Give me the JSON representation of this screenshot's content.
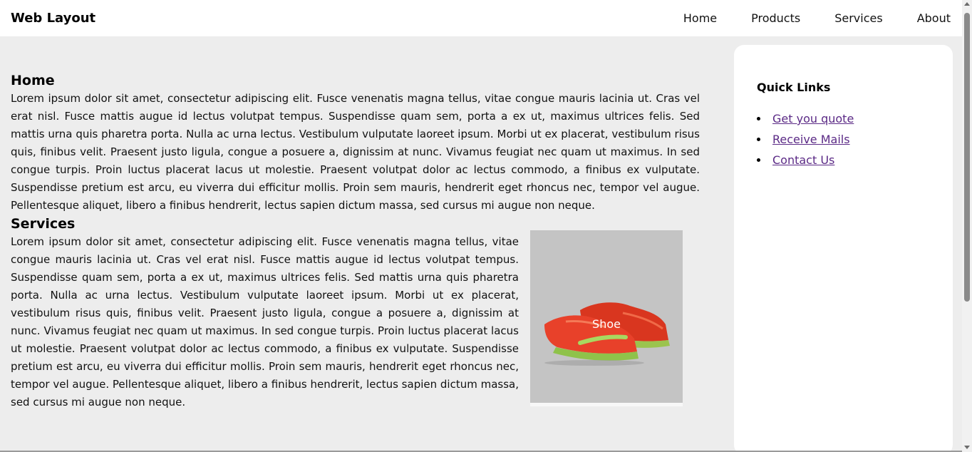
{
  "header": {
    "brand": "Web Layout",
    "nav": [
      "Home",
      "Products",
      "Services",
      "About"
    ]
  },
  "home": {
    "title": "Home",
    "text": "Lorem ipsum dolor sit amet, consectetur adipiscing elit. Fusce venenatis magna tellus, vitae congue mauris lacinia ut. Cras vel erat nisl. Fusce mattis augue id lectus volutpat tempus. Suspendisse quam sem, porta a ex ut, maximus ultrices felis. Sed mattis urna quis pharetra porta. Nulla ac urna lectus. Vestibulum vulputate laoreet ipsum. Morbi ut ex placerat, vestibulum risus quis, finibus velit. Praesent justo ligula, congue a posuere a, dignissim at nunc. Vivamus feugiat nec quam ut maximus. In sed congue turpis. Proin luctus placerat lacus ut molestie. Praesent volutpat dolor ac lectus commodo, a finibus ex vulputate. Suspendisse pretium est arcu, eu viverra dui efficitur mollis. Proin sem mauris, hendrerit eget rhoncus nec, tempor vel augue. Pellentesque aliquet, libero a finibus hendrerit, lectus sapien dictum massa, sed cursus mi augue non neque."
  },
  "services": {
    "title": "Services",
    "text": "Lorem ipsum dolor sit amet, consectetur adipiscing elit. Fusce venenatis magna tellus, vitae congue mauris lacinia ut. Cras vel erat nisl. Fusce mattis augue id lectus volutpat tempus. Suspendisse quam sem, porta a ex ut, maximus ultrices felis. Sed mattis urna quis pharetra porta. Nulla ac urna lectus. Vestibulum vulputate laoreet ipsum. Morbi ut ex placerat, vestibulum risus quis, finibus velit. Praesent justo ligula, congue a posuere a, dignissim at nunc. Vivamus feugiat nec quam ut maximus. In sed congue turpis. Proin luctus placerat lacus ut molestie. Praesent volutpat dolor ac lectus commodo, a finibus ex vulputate. Suspendisse pretium est arcu, eu viverra dui efficitur mollis. Proin sem mauris, hendrerit eget rhoncus nec, tempor vel augue. Pellentesque aliquet, libero a finibus hendrerit, lectus sapien dictum massa, sed cursus mi augue non neque.",
    "product_caption": "Shoe"
  },
  "sidebar": {
    "title": "Quick Links",
    "links": [
      "Get you quote",
      "Receive Mails",
      "Contact Us"
    ]
  },
  "colors": {
    "background": "#ededed",
    "link": "#5b2a86",
    "product_bg": "#c4c4c4",
    "shoe": "#e8412a",
    "shoe_sole": "#8fc24a"
  }
}
